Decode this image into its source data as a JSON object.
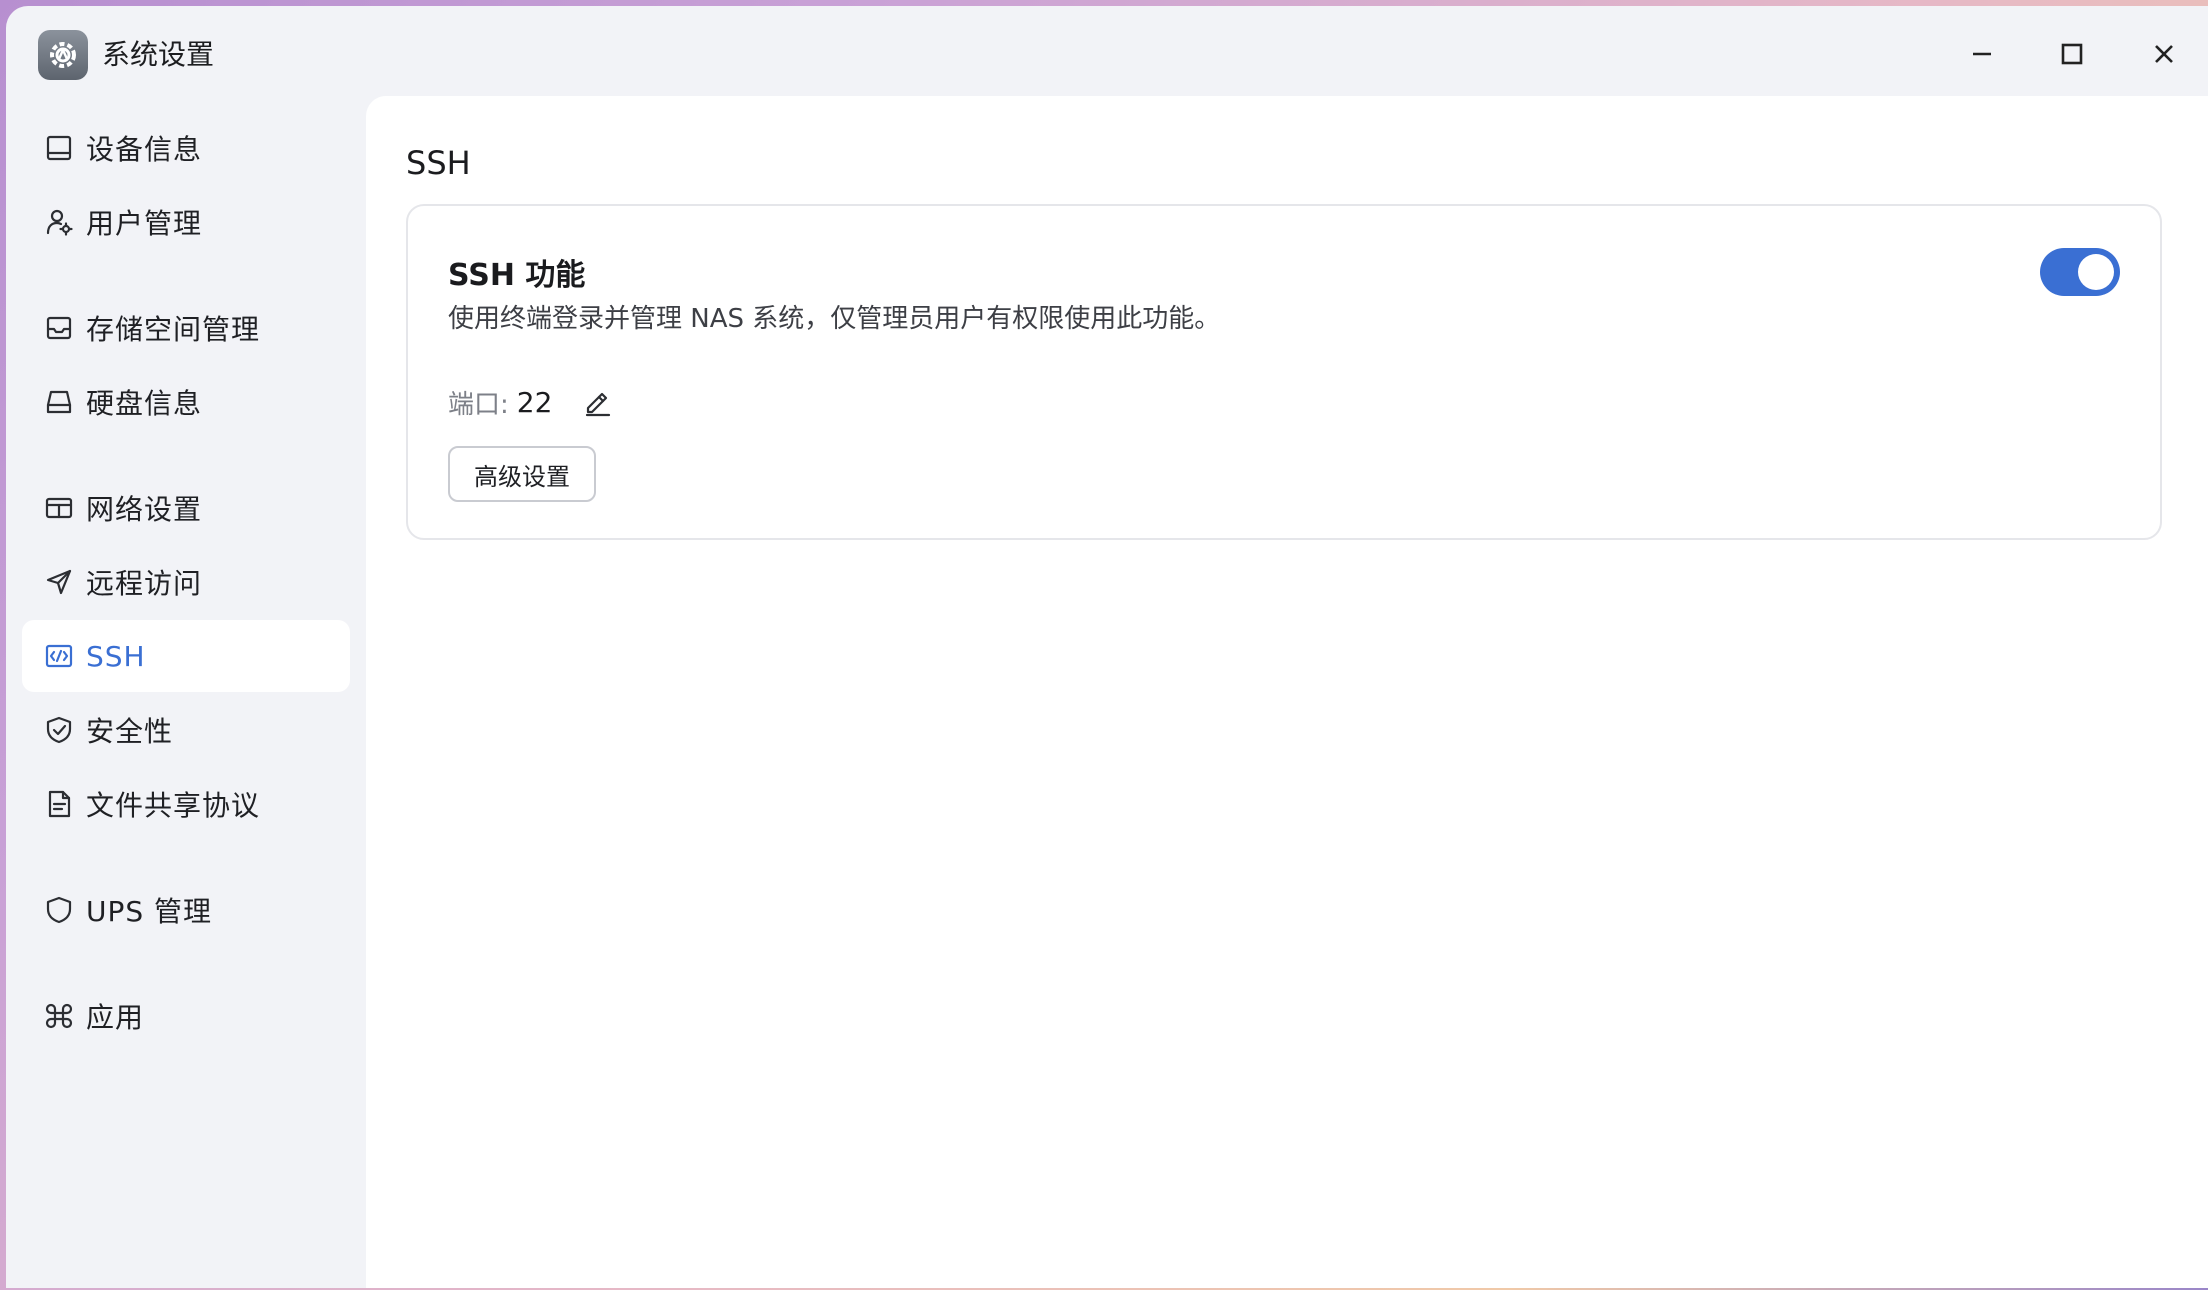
{
  "window": {
    "title": "系统设置",
    "app_icon": "gear-icon"
  },
  "window_controls": {
    "minimize": "minimize-icon",
    "maximize": "maximize-icon",
    "close": "close-icon"
  },
  "sidebar": {
    "items": [
      {
        "label": "设备信息",
        "icon": "device-icon",
        "active": false
      },
      {
        "label": "用户管理",
        "icon": "user-gear-icon",
        "active": false
      },
      {
        "label": "存储空间管理",
        "icon": "storage-icon",
        "active": false
      },
      {
        "label": "硬盘信息",
        "icon": "disk-icon",
        "active": false
      },
      {
        "label": "网络设置",
        "icon": "network-icon",
        "active": false
      },
      {
        "label": "远程访问",
        "icon": "send-icon",
        "active": false
      },
      {
        "label": "SSH",
        "icon": "code-icon",
        "active": true
      },
      {
        "label": "安全性",
        "icon": "shield-check-icon",
        "active": false
      },
      {
        "label": "文件共享协议",
        "icon": "file-icon",
        "active": false
      },
      {
        "label": "UPS 管理",
        "icon": "shield-icon",
        "active": false
      },
      {
        "label": "应用",
        "icon": "command-icon",
        "active": false
      }
    ]
  },
  "main": {
    "page_title": "SSH",
    "ssh_card": {
      "title": "SSH 功能",
      "description": "使用终端登录并管理 NAS 系统，仅管理员用户有权限使用此功能。",
      "enabled": true,
      "port_label": "端口:",
      "port_value": "22",
      "advanced_button": "高级设置"
    }
  },
  "colors": {
    "accent": "#3a6fd3",
    "window_bg": "#f2f3f7",
    "panel_bg": "#ffffff"
  }
}
